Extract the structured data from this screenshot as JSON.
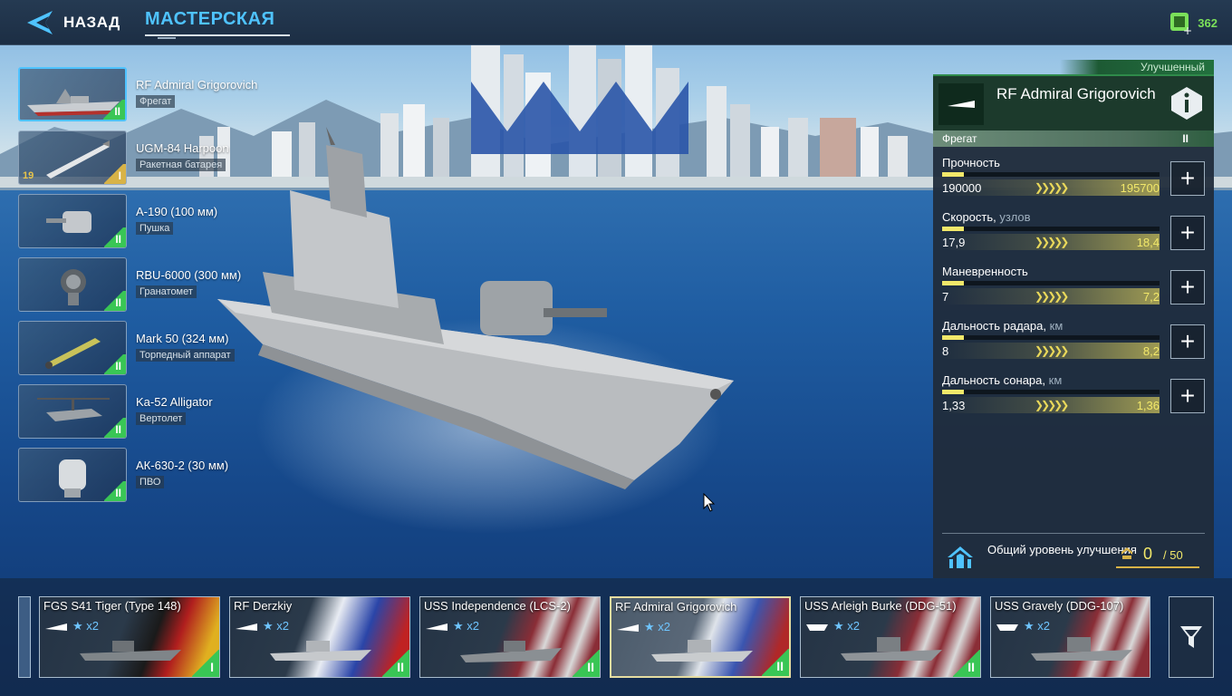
{
  "topbar": {
    "back_label": "НАЗАД",
    "title": "МАСТЕРСКАЯ",
    "currency_value": "362",
    "back_icon": "chevron-left-logo-icon",
    "currency_icon": "green-chip-plus-icon"
  },
  "equipment": [
    {
      "name": "RF Admiral Grigorovich",
      "type": "Фрегат",
      "tier": "II",
      "icon": "frigate-icon",
      "selected": true
    },
    {
      "name": "UGM-84 Harpoon",
      "type": "Ракетная батарея",
      "tier": "I",
      "level": "19",
      "icon": "missile-icon"
    },
    {
      "name": "А-190 (100 мм)",
      "type": "Пушка",
      "tier": "II",
      "icon": "gun-turret-icon"
    },
    {
      "name": "RBU-6000 (300 мм)",
      "type": "Гранатомет",
      "tier": "II",
      "icon": "rocket-launcher-icon"
    },
    {
      "name": "Mark 50 (324 мм)",
      "type": "Торпедный аппарат",
      "tier": "II",
      "icon": "torpedo-icon"
    },
    {
      "name": "Ka-52 Alligator",
      "type": "Вертолет",
      "tier": "II",
      "icon": "helicopter-icon"
    },
    {
      "name": "АК-630-2 (30 мм)",
      "type": "ПВО",
      "tier": "II",
      "icon": "ciws-icon"
    }
  ],
  "panel": {
    "tag": "Улучшенный",
    "ship_name": "RF Admiral Grigorovich",
    "ship_class": "Фрегат",
    "tier": "II",
    "stats": [
      {
        "label": "Прочность",
        "unit": "",
        "current": "190000",
        "max": "195700",
        "fill": 0.1
      },
      {
        "label": "Скорость,",
        "unit": "узлов",
        "current": "17,9",
        "max": "18,4",
        "fill": 0.1
      },
      {
        "label": "Маневренность",
        "unit": "",
        "current": "7",
        "max": "7,2",
        "fill": 0.1
      },
      {
        "label": "Дальность радара,",
        "unit": "км",
        "current": "8",
        "max": "8,2",
        "fill": 0.1
      },
      {
        "label": "Дальность сонара,",
        "unit": "км",
        "current": "1,33",
        "max": "1,36",
        "fill": 0.1
      }
    ],
    "footer": {
      "label": "Общий уровень улучшения",
      "current": "0",
      "max": "/ 50"
    }
  },
  "ships": [
    {
      "name": "FGS S41 Tiger (Type 148)",
      "stars": "x2",
      "tier": "I",
      "flag": "germany"
    },
    {
      "name": "RF Derzkiy",
      "stars": "x2",
      "tier": "II",
      "flag": "russia"
    },
    {
      "name": "USS Independence (LCS-2)",
      "stars": "x2",
      "tier": "II",
      "flag": "usa"
    },
    {
      "name": "RF Admiral Grigorovich",
      "stars": "x2",
      "tier": "II",
      "flag": "russia",
      "selected": true
    },
    {
      "name": "USS Arleigh Burke (DDG-51)",
      "stars": "x2",
      "tier": "II",
      "flag": "usa"
    },
    {
      "name": "USS Gravely (DDG-107)",
      "stars": "x2",
      "tier": "",
      "flag": "usa"
    }
  ]
}
